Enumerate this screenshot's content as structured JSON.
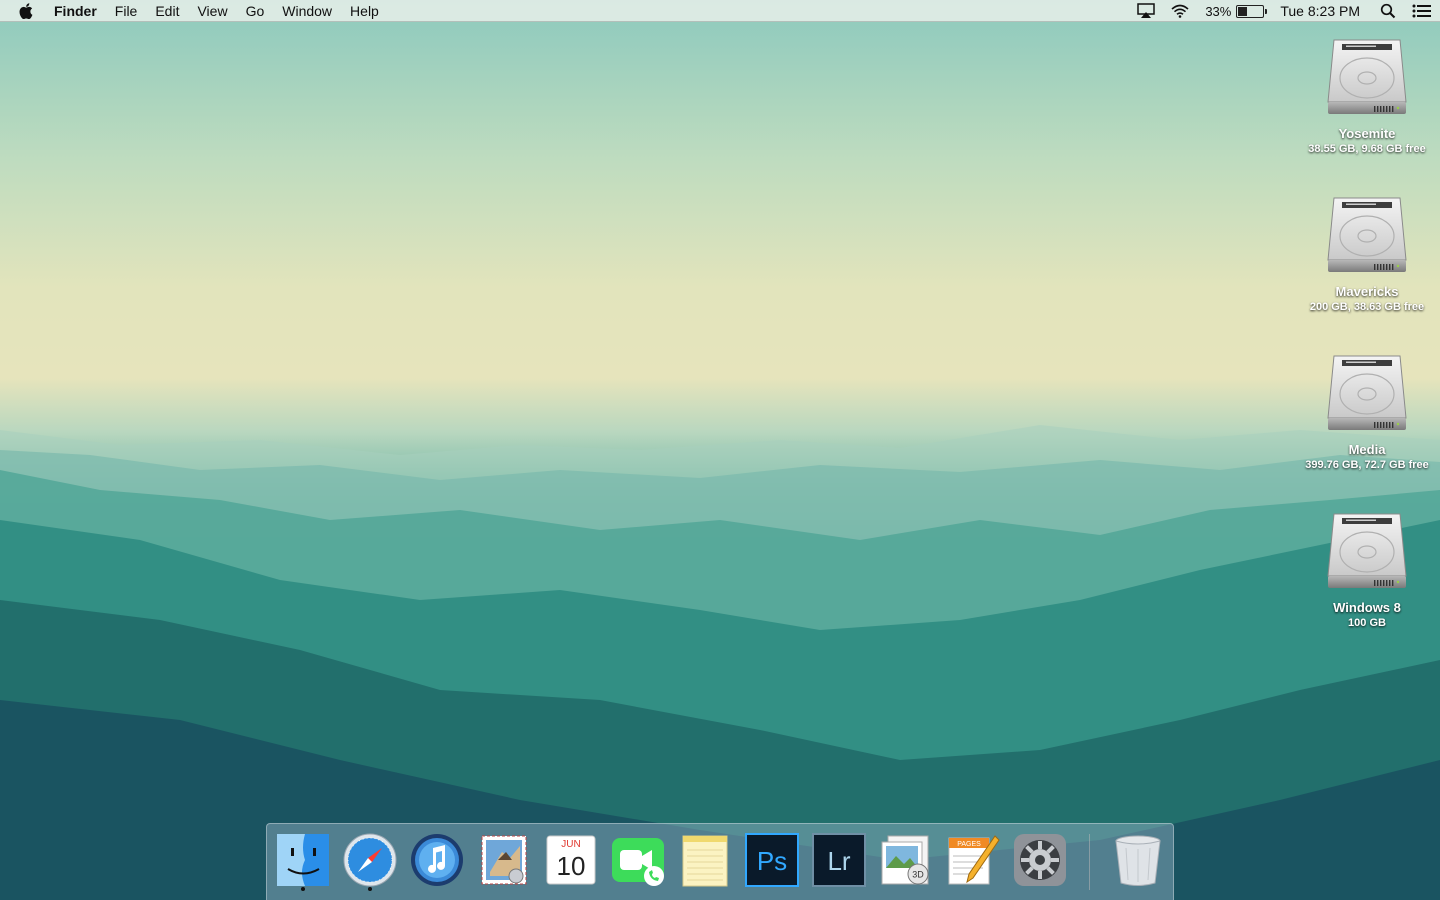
{
  "menubar": {
    "app_name": "Finder",
    "menus": [
      "File",
      "Edit",
      "View",
      "Go",
      "Window",
      "Help"
    ],
    "battery_percent_label": "33%",
    "battery_level": 0.33,
    "clock": "Tue 8:23 PM",
    "icons": [
      "apple-icon",
      "airplay-icon",
      "wifi-icon",
      "battery-icon",
      "spotlight-icon",
      "notification-center-icon"
    ]
  },
  "drives": [
    {
      "name": "Yosemite",
      "info": "38.55 GB, 9.68 GB free"
    },
    {
      "name": "Mavericks",
      "info": "200 GB, 38.63 GB free"
    },
    {
      "name": "Media",
      "info": "399.76 GB, 72.7 GB free"
    },
    {
      "name": "Windows 8",
      "info": "100 GB"
    }
  ],
  "dock": {
    "apps": [
      {
        "name": "finder-icon",
        "running": true
      },
      {
        "name": "safari-icon",
        "running": true
      },
      {
        "name": "itunes-icon",
        "running": false
      },
      {
        "name": "mail-icon",
        "running": false
      },
      {
        "name": "calendar-icon",
        "running": false
      },
      {
        "name": "facetime-icon",
        "running": false
      },
      {
        "name": "notes-icon",
        "running": false
      },
      {
        "name": "photoshop-icon",
        "running": false
      },
      {
        "name": "lightroom-icon",
        "running": false
      },
      {
        "name": "preview-icon",
        "running": false
      },
      {
        "name": "pages-icon",
        "running": false
      },
      {
        "name": "system-preferences-icon",
        "running": false
      },
      {
        "name": "trash-icon",
        "running": false
      }
    ],
    "calendar_month": "JUN",
    "calendar_day": "10",
    "photoshop_label": "Ps",
    "lightroom_label": "Lr",
    "preview_badge": "3D",
    "pages_label": "PAGES"
  },
  "colors": {
    "accent_photoshop": "#31a8ff",
    "accent_lightroom": "#add5ec",
    "facetime_green": "#3ddc5a"
  }
}
